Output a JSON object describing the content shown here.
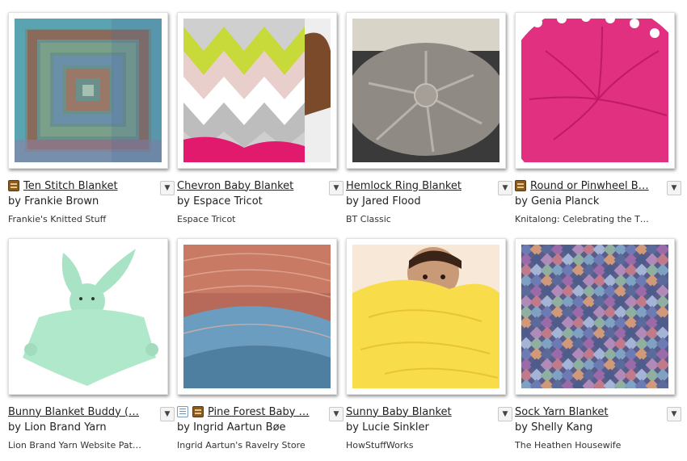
{
  "colors": {
    "accent": "#e21a6e",
    "text": "#222222",
    "dropdown_border": "#c8c8c8"
  },
  "cards": [
    {
      "title": "Ten Stitch Blanket",
      "author": "by Frankie Brown",
      "source": "Frankie's Knitted Stuff",
      "badges": [
        "book-icon"
      ]
    },
    {
      "title": "Chevron Baby Blanket",
      "author": "by Espace Tricot",
      "source": "Espace Tricot",
      "badges": []
    },
    {
      "title": "Hemlock Ring Blanket",
      "author": "by Jared Flood",
      "source": "BT Classic",
      "badges": []
    },
    {
      "title": "Round or Pinwheel B…",
      "author": "by Genia Planck",
      "source": "Knitalong: Celebrating the T…",
      "badges": [
        "book-icon"
      ]
    },
    {
      "title": "Bunny Blanket Buddy (…",
      "author": "by Lion Brand Yarn",
      "source": "Lion Brand Yarn Website Pat…",
      "badges": []
    },
    {
      "title": "Pine Forest Baby …",
      "author": "by Ingrid Aartun Bøe",
      "source": "Ingrid Aartun's Ravelry Store",
      "badges": [
        "page-icon",
        "book-icon"
      ]
    },
    {
      "title": "Sunny Baby Blanket",
      "author": "by Lucie Sinkler",
      "source": "HowStuffWorks",
      "badges": []
    },
    {
      "title": "Sock Yarn Blanket",
      "author": "by Shelly Kang",
      "source": "The Heathen Housewife",
      "badges": []
    }
  ],
  "dropdown_glyph": "▼"
}
